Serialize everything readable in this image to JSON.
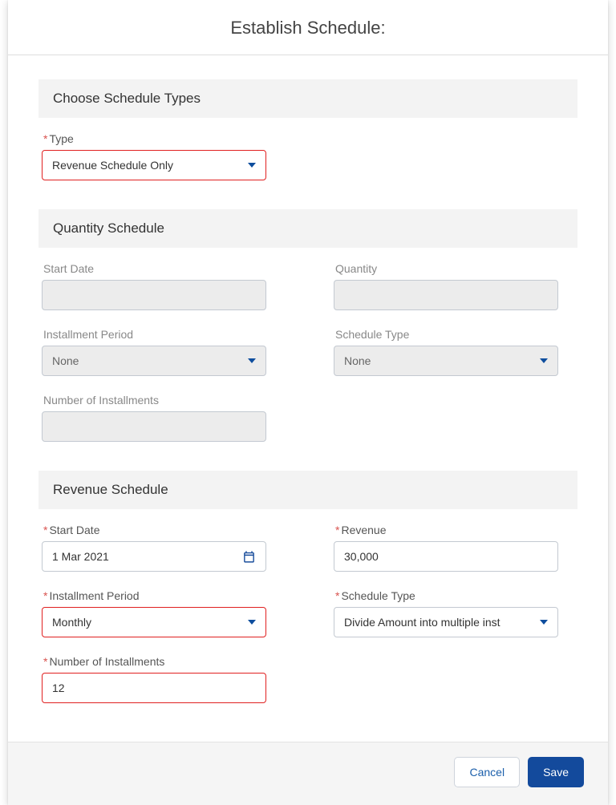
{
  "header": {
    "title": "Establish Schedule:"
  },
  "sections": {
    "chooseTypes": {
      "title": "Choose Schedule Types",
      "type": {
        "label": "Type",
        "value": "Revenue Schedule Only",
        "required": true
      }
    },
    "quantity": {
      "title": "Quantity Schedule",
      "startDate": {
        "label": "Start Date",
        "value": ""
      },
      "quantity": {
        "label": "Quantity",
        "value": ""
      },
      "installmentPeriod": {
        "label": "Installment Period",
        "value": "None"
      },
      "scheduleType": {
        "label": "Schedule Type",
        "value": "None"
      },
      "numInstallments": {
        "label": "Number of Installments",
        "value": ""
      }
    },
    "revenue": {
      "title": "Revenue Schedule",
      "startDate": {
        "label": "Start Date",
        "value": "1 Mar 2021",
        "required": true
      },
      "revenue": {
        "label": "Revenue",
        "value": "30,000",
        "required": true
      },
      "installmentPeriod": {
        "label": "Installment Period",
        "value": "Monthly",
        "required": true
      },
      "scheduleType": {
        "label": "Schedule Type",
        "value": "Divide Amount into multiple inst",
        "required": true
      },
      "numInstallments": {
        "label": "Number of Installments",
        "value": "12",
        "required": true
      }
    }
  },
  "footer": {
    "cancel": "Cancel",
    "save": "Save"
  }
}
